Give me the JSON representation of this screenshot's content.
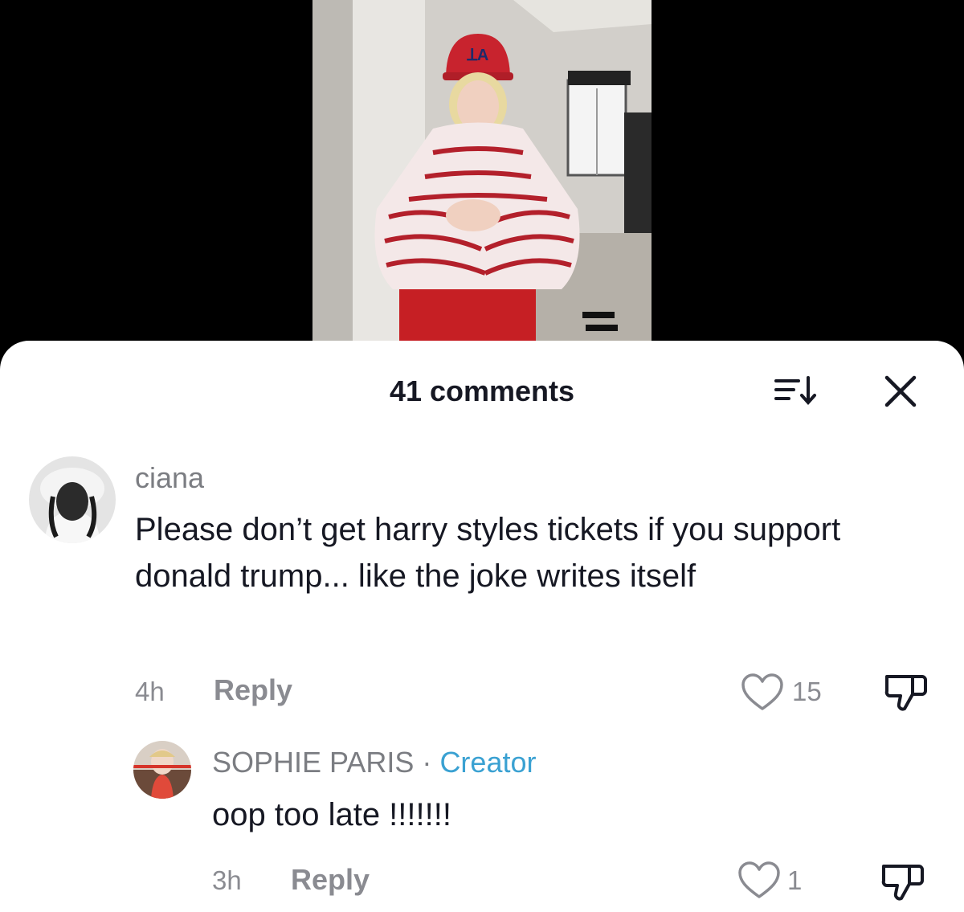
{
  "header": {
    "comment_count": "41 comments",
    "sort_icon": "sort-descending-icon",
    "close_icon": "close-icon"
  },
  "comments": [
    {
      "username": "ciana",
      "text": "Please don’t get harry styles tickets if you support donald trump... like the joke writes itself",
      "time": "4h",
      "reply_label": "Reply",
      "likes": "15"
    }
  ],
  "replies": [
    {
      "username": "SOPHIE PARIS",
      "separator": "·",
      "tag": "Creator",
      "text": "oop too late !!!!!!!",
      "time": "3h",
      "reply_label": "Reply",
      "likes": "1"
    }
  ],
  "colors": {
    "creator_tag": "#3aa1d2",
    "text_primary": "#161823",
    "text_secondary": "#8a8b91"
  }
}
